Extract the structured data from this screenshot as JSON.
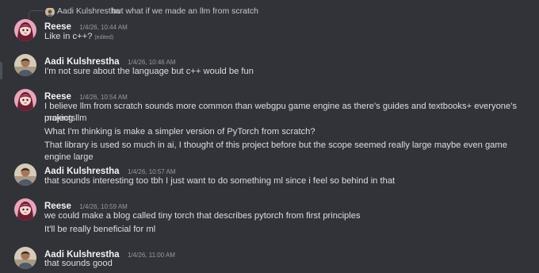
{
  "reply": {
    "author": "Aadi Kulshrestha",
    "text": "but what if we made an llm from scratch"
  },
  "messages": [
    {
      "author": "Reese",
      "timestamp": "1/4/26, 10:44 AM",
      "lines": [
        "Like in c++?"
      ],
      "edited": "(edited)"
    },
    {
      "author": "Aadi Kulshrestha",
      "timestamp": "1/4/26, 10:46 AM",
      "lines": [
        "I'm not sure about the language but c++ would be fun"
      ]
    },
    {
      "author": "Reese",
      "timestamp": "1/4/26, 10:54 AM",
      "lines": [
        "I believe llm from scratch sounds more common than webgpu game engine as there's guides and textbooks+ everyone's making llm",
        "projects",
        "What I'm thinking is make a simpler version of PyTorch from scratch?",
        "That library is used so much in ai, I thought of this project before but the scope seemed really large maybe even game engine large"
      ]
    },
    {
      "author": "Aadi Kulshrestha",
      "timestamp": "1/4/26, 10:57 AM",
      "lines": [
        "that sounds interesting too tbh I just want to do something ml since i feel so behind in that"
      ]
    },
    {
      "author": "Reese",
      "timestamp": "1/4/26, 10:59 AM",
      "lines": [
        "we could make a blog called tiny torch that describes pytorch from first principles",
        "It'll be really beneficial for ml"
      ]
    },
    {
      "author": "Aadi Kulshrestha",
      "timestamp": "1/4/26, 11:00 AM",
      "lines": [
        "that sounds good"
      ]
    }
  ],
  "colors": {
    "background": "#313338",
    "username": "#f2f3f5",
    "text": "#dbdee1",
    "timestamp": "#949ba4"
  },
  "icons": {
    "reese_avatar": "anime-character-avatar",
    "aadi_avatar": "user-photo-avatar"
  }
}
